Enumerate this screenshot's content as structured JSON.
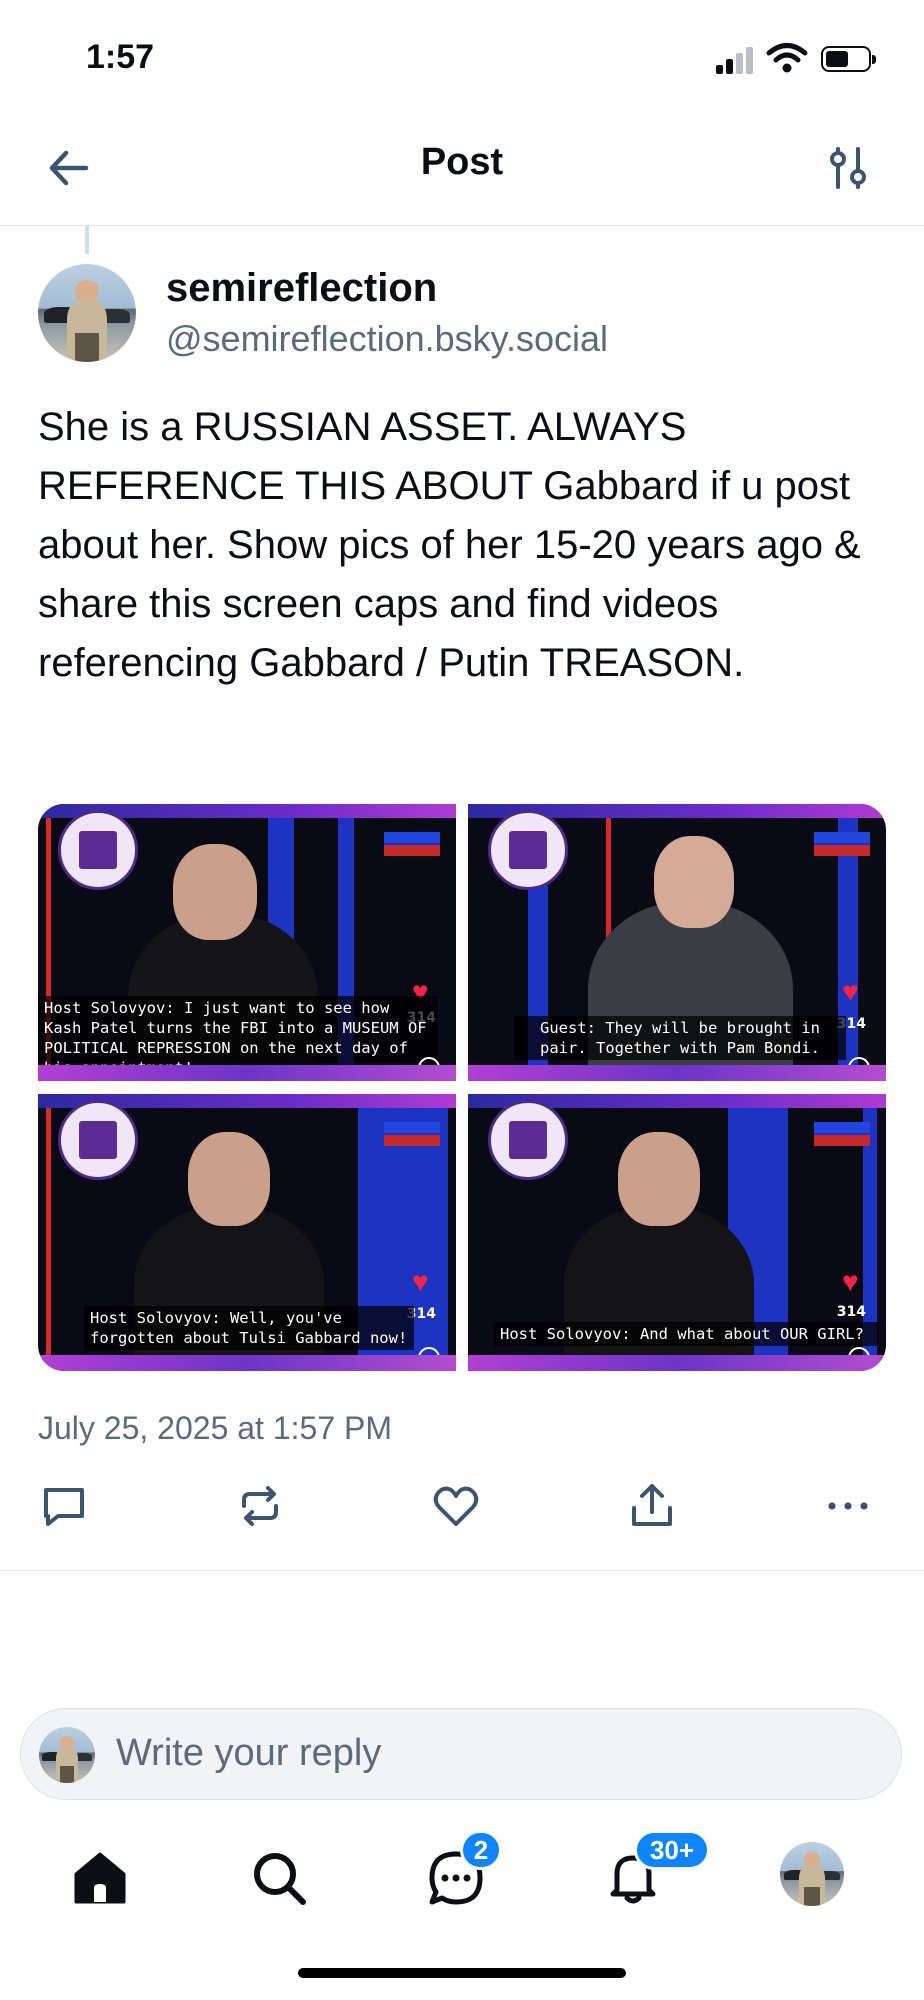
{
  "status_bar": {
    "time": "1:57"
  },
  "header": {
    "title": "Post"
  },
  "post": {
    "display_name": "semireflection",
    "handle": "@semireflection.bsky.social",
    "text": "She is a RUSSIAN ASSET. ALWAYS REFERENCE THIS ABOUT Gabbard if u post about her. Show pics of her 15-20 years ago & share this screen caps and find videos referencing Gabbard / Putin TREASON.",
    "images": [
      {
        "caption": "Host Solovyov: I just want to see how Kash Patel turns the FBI into a MUSEUM OF POLITICAL REPRESSION on the next day of his appointment!",
        "count": "314"
      },
      {
        "caption": "Guest: They will be brought in pair. Together with Pam Bondi.",
        "count": "314"
      },
      {
        "caption": "Host Solovyov: Well, you've forgotten about Tulsi Gabbard now!",
        "count": "314"
      },
      {
        "caption": "Host Solovyov: And what about OUR GIRL?",
        "count": "314"
      }
    ],
    "timestamp": "July 25, 2025 at 1:57 PM"
  },
  "actions": [
    "reply-icon",
    "repost-icon",
    "like-icon",
    "share-icon",
    "more-icon"
  ],
  "reply_bar": {
    "placeholder": "Write your reply"
  },
  "tabbar": {
    "chat_badge": "2",
    "notifications_badge": "30+"
  },
  "colors": {
    "accent": "#1083fe",
    "heart": "#ff2247",
    "muted_text": "#5b6b7e"
  }
}
